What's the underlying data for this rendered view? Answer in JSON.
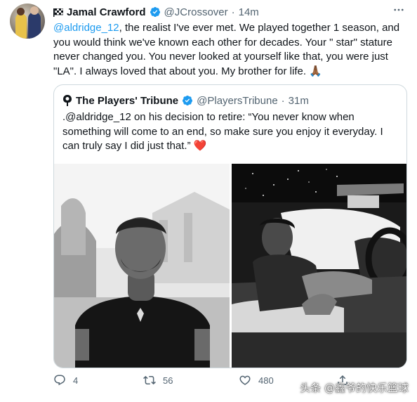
{
  "tweet": {
    "author_name": "Jamal Crawford",
    "handle": "@JCrossover",
    "separator": "·",
    "time": "14m",
    "mention": "@aldridge_12",
    "body": ", the realist I've ever met. We played together 1 season, and you would think we've known each other for decades. Your \" star\" stature never changed you. You never looked at yourself like that, you were just \"LA\". I always loved that about you. My brother for life. 🙏🏾"
  },
  "quoted": {
    "author_name": "The Players' Tribune",
    "handle": "@PlayersTribune",
    "separator": "·",
    "time": "31m",
    "body": ".@aldridge_12 on his decision to retire: “You never know when something will come to an end, so make sure you enjoy it everyday. I can truly say I did just that.” ❤️"
  },
  "actions": {
    "reply_count": "4",
    "retweet_count": "56",
    "like_count": "480"
  },
  "watermark": "头条 @鑫爷的快乐篮球",
  "colors": {
    "accent": "#1d9bf0",
    "text": "#0f1419",
    "secondary": "#536471",
    "border": "#cfd9de"
  },
  "icons": [
    "flag-icon",
    "verified-icon",
    "more-icon",
    "reply-icon",
    "retweet-icon",
    "like-icon",
    "share-icon"
  ]
}
